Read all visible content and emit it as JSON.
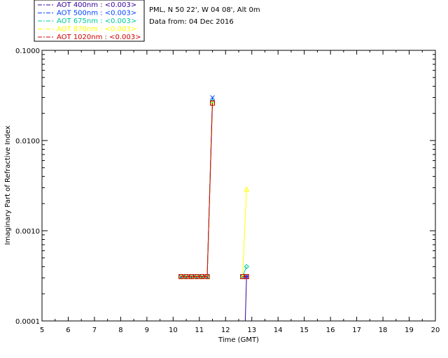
{
  "header": {
    "site": "PML, N 50 22', W 04 08', Alt 0m",
    "date": "Data from: 04 Dec 2016"
  },
  "chart_data": {
    "type": "line",
    "xlabel": "Time (GMT)",
    "ylabel": "Imaginary Part of Refractive Index",
    "xlim": [
      5,
      20
    ],
    "ylim": [
      0.0001,
      0.1
    ],
    "yscale": "log",
    "xticks": [
      "5",
      "6",
      "7",
      "8",
      "9",
      "10",
      "11",
      "12",
      "13",
      "14",
      "15",
      "16",
      "17",
      "18",
      "19",
      "20"
    ],
    "yticks": [
      "0.0001",
      "0.0010",
      "0.0100",
      "0.1000"
    ],
    "grid": false,
    "legend_position": "top-left, outside plot",
    "series": [
      {
        "name": "AOT  400nm : <0.003>",
        "color": "#330099",
        "marker": "plus",
        "points": [
          [
            10.3,
            0.00031
          ],
          [
            10.5,
            0.00031
          ],
          [
            10.7,
            0.00031
          ],
          [
            10.9,
            0.00031
          ],
          [
            11.1,
            0.00031
          ],
          [
            11.3,
            0.00031
          ],
          [
            11.5,
            0.028
          ],
          [
            12.75,
            0.0001
          ],
          [
            12.8,
            0.00031
          ]
        ]
      },
      {
        "name": "AOT  500nm : <0.003>",
        "color": "#0044ff",
        "marker": "x",
        "points": [
          [
            10.3,
            0.00031
          ],
          [
            10.5,
            0.00031
          ],
          [
            10.7,
            0.00031
          ],
          [
            10.9,
            0.00031
          ],
          [
            11.1,
            0.00031
          ],
          [
            11.3,
            0.00031
          ],
          [
            11.5,
            0.03
          ],
          [
            12.65,
            0.00031
          ],
          [
            12.8,
            0.00031
          ]
        ]
      },
      {
        "name": "AOT  675nm : <0.003>",
        "color": "#00cc99",
        "marker": "diamond",
        "points": [
          [
            10.3,
            0.00031
          ],
          [
            10.5,
            0.00031
          ],
          [
            10.7,
            0.00031
          ],
          [
            10.9,
            0.00031
          ],
          [
            11.1,
            0.00031
          ],
          [
            11.3,
            0.00031
          ],
          [
            11.5,
            0.027
          ],
          [
            12.65,
            0.00031
          ],
          [
            12.8,
            0.0004
          ]
        ]
      },
      {
        "name": "AOT  870nm : <0.003>",
        "color": "#ffff00",
        "marker": "triangle",
        "points": [
          [
            10.3,
            0.00031
          ],
          [
            10.5,
            0.00031
          ],
          [
            10.7,
            0.00031
          ],
          [
            10.9,
            0.00031
          ],
          [
            11.1,
            0.00031
          ],
          [
            11.3,
            0.00031
          ],
          [
            11.5,
            0.026
          ],
          [
            12.65,
            0.00031
          ],
          [
            12.8,
            0.0029
          ]
        ]
      },
      {
        "name": "AOT 1020nm : <0.003>",
        "color": "#cc0000",
        "marker": "square",
        "points": [
          [
            10.3,
            0.00031
          ],
          [
            10.5,
            0.00031
          ],
          [
            10.7,
            0.00031
          ],
          [
            10.9,
            0.00031
          ],
          [
            11.1,
            0.00031
          ],
          [
            11.3,
            0.00031
          ],
          [
            11.5,
            0.026
          ],
          [
            12.65,
            0.00031
          ],
          [
            12.8,
            0.00031
          ]
        ]
      }
    ]
  }
}
